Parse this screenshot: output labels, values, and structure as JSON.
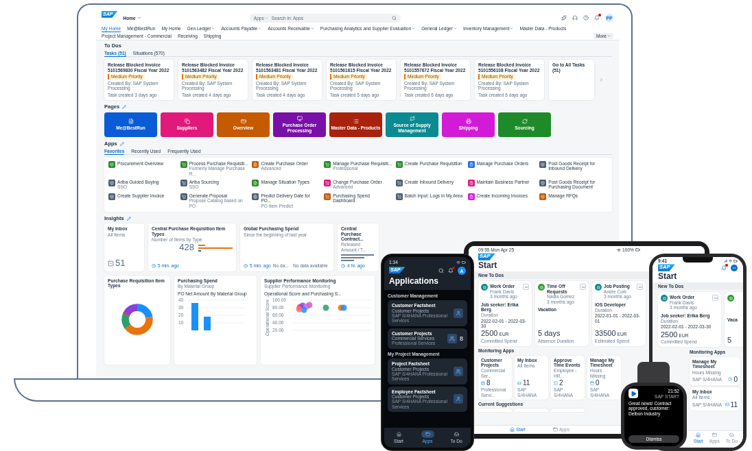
{
  "laptop": {
    "shell": {
      "logo": "SAP",
      "home_menu": "Home",
      "search": {
        "scope": "Apps",
        "placeholder": "Search in: Apps"
      },
      "unread": true,
      "avatar": "PP"
    },
    "nav": [
      {
        "label": "My Home",
        "selected": true,
        "dropdown": false
      },
      {
        "label": "Me@BestRun",
        "selected": false,
        "dropdown": false
      },
      {
        "label": "My Home",
        "selected": false,
        "dropdown": false
      },
      {
        "label": "Gen.Ledger",
        "selected": false,
        "dropdown": true
      },
      {
        "label": "Accounts Payable",
        "selected": false,
        "dropdown": true
      },
      {
        "label": "Accounts Receivable",
        "selected": false,
        "dropdown": true
      },
      {
        "label": "Purchasing Analytics and Supplier Evaluation",
        "selected": false,
        "dropdown": true
      },
      {
        "label": "General Ledger",
        "selected": false,
        "dropdown": true
      },
      {
        "label": "Inventory Management",
        "selected": false,
        "dropdown": true
      },
      {
        "label": "Master Data - Products",
        "selected": false,
        "dropdown": false
      },
      {
        "label": "Project Management - Commercial",
        "selected": false,
        "dropdown": false
      },
      {
        "label": "Receiving",
        "selected": false,
        "dropdown": false
      },
      {
        "label": "Shipping",
        "selected": false,
        "dropdown": false
      }
    ],
    "more": "More",
    "todos": {
      "title": "To Dos",
      "tabs": [
        {
          "label": "Tasks (51)",
          "selected": true
        },
        {
          "label": "Situations (570)",
          "selected": false
        }
      ],
      "tasks": [
        {
          "title": "Release Blocked Invoice 5101569830 Fiscal Year 2022",
          "priority": "Medium Priority",
          "created_by": "Created By: SAP System Processing",
          "age": "Task created 3 days ago"
        },
        {
          "title": "Release Blocked Invoice 5101563482 Fiscal Year 2022",
          "priority": "Medium Priority",
          "created_by": "Created By: SAP System Processing",
          "age": "Task created 4 days ago"
        },
        {
          "title": "Release Blocked Invoice 5101563481 Fiscal Year 2022",
          "priority": "Medium Priority",
          "created_by": "Created By: SAP System Processing",
          "age": "Task created 4 days ago"
        },
        {
          "title": "Release Blocked Invoice 5101561615 Fiscal Year 2022",
          "priority": "Medium Priority",
          "created_by": "Created By: SAP System Processing",
          "age": "Task created 5 days ago"
        },
        {
          "title": "Release Blocked Invoice 5101557672 Fiscal Year 2022",
          "priority": "Medium Priority",
          "created_by": "Created By: SAP System Processing",
          "age": "Task created 6 days ago"
        },
        {
          "title": "Release Blocked Invoice 5101556108 Fiscal Year 2022",
          "priority": "Medium Priority",
          "created_by": "Created By: SAP System Processing",
          "age": "Task created 6 days ago"
        }
      ],
      "all_tasks": "Go to All Tasks (51)"
    },
    "pages": {
      "title": "Pages",
      "tiles": [
        {
          "label": "Me@BestRun",
          "color": "#0a5bd6"
        },
        {
          "label": "Suppliers",
          "color": "#e0197a"
        },
        {
          "label": "Overview",
          "color": "#c55a00"
        },
        {
          "label": "Purchase Order Processing",
          "color": "#7a10a8"
        },
        {
          "label": "Master Data - Products",
          "color": "#a8220d"
        },
        {
          "label": "Source of Supply Management",
          "color": "#0b8a93"
        },
        {
          "label": "Shipping",
          "color": "#d21bd6"
        },
        {
          "label": "Sourcing",
          "color": "#1f8a2a"
        }
      ]
    },
    "apps": {
      "title": "Apps",
      "tabs": [
        {
          "label": "Favorites",
          "selected": true
        },
        {
          "label": "Recently Used",
          "selected": false
        },
        {
          "label": "Frequently Used",
          "selected": false
        }
      ],
      "items": [
        {
          "title": "Procurement Overview",
          "color": "#2b8a2b"
        },
        {
          "title": "Process Purchase Requisiti...",
          "subtitle": "Formerly Manage Purchase R...",
          "color": "#2b8a2b"
        },
        {
          "title": "Create Purchase Order",
          "subtitle": "Advanced",
          "color": "#c55a00"
        },
        {
          "title": "Manage Purchase Requisiti...",
          "subtitle": "Professional",
          "color": "#2b8a2b"
        },
        {
          "title": "Create Purchase Requisition",
          "color": "#2b8a2b"
        },
        {
          "title": "Manage Purchase Orders",
          "color": "#1a6ee6"
        },
        {
          "title": "Post Goods Receipt for Inbound Delivery",
          "color": "#4c5e73"
        },
        {
          "title": "Ariba Guided Buying",
          "subtitle": "SSO",
          "color": "#4c5e73"
        },
        {
          "title": "Ariba Sourcing",
          "subtitle": "SSO",
          "color": "#4c5e73"
        },
        {
          "title": "Manage Situation Types",
          "color": "#2b8a2b"
        },
        {
          "title": "Change Purchase Order",
          "subtitle": "Advanced",
          "color": "#e0197a"
        },
        {
          "title": "Create Inbound Delivery",
          "color": "#4c5e73"
        },
        {
          "title": "Maintain Business Partner",
          "color": "#e0197a"
        },
        {
          "title": "Post Goods Receipt for Purchasing Document",
          "color": "#4c5e73"
        },
        {
          "title": "Create Supplier Invoice",
          "color": "#4c5e73"
        },
        {
          "title": "Generate Proposal",
          "subtitle": "Propose Catalog based on PO",
          "color": "#4c5e73"
        },
        {
          "title": "Predict Delivery Date for PO...",
          "subtitle": "PO Item Predict",
          "color": "#4c5e73"
        },
        {
          "title": "Purchasing Spend Dashboard",
          "color": "#c55a00"
        },
        {
          "title": "Batch Input: Logs in My Area",
          "color": "#4c5e73"
        },
        {
          "title": "Create Incoming Invoices",
          "color": "#d21bd6"
        },
        {
          "title": "Manage RFQs",
          "color": "#c55a00"
        }
      ]
    },
    "insights": {
      "title": "Insights",
      "cards": [
        {
          "kind": "count",
          "title": "My Inbox",
          "subtitle": "All Items",
          "value": "51"
        },
        {
          "kind": "numbers",
          "title": "Central Purchase Requisition Item Types",
          "subtitle": "Number of Items by Type",
          "value": "428",
          "footer": "5 min. ago"
        },
        {
          "kind": "empty",
          "title": "Global Purchasing Spend",
          "subtitle": "Since the beginning of last year",
          "footer": "5 min. ago",
          "note": "No da...",
          "message": "No data available"
        },
        {
          "kind": "list",
          "title": "Central Purchase Contract...",
          "subtitle": "Released Amount / T...",
          "footer": "4 hr. ago"
        }
      ],
      "charts": [
        {
          "kind": "donut",
          "title": "Purchase Requisition Item Types"
        },
        {
          "kind": "bar",
          "title": "Purchasing Spend",
          "subtitle": "By Material Group",
          "chart_title": "PO Net Amount By Material Group",
          "ticks": [
            "40",
            "30",
            "20",
            "10"
          ]
        },
        {
          "kind": "scatter",
          "title": "Supplier Performance Monitoring",
          "subtitle": "Supplier Performance Monitoring",
          "chart_title": "Operational Score and Purchasing S...",
          "axis_label": "Operational Score",
          "ticks": [
            "100.00",
            "80.00",
            "60.00",
            "40.00",
            "20.00"
          ]
        }
      ]
    }
  },
  "android_phone": {
    "time": "1:34",
    "logo": "SAP",
    "unread": true,
    "avatar": "A",
    "title": "Applications",
    "sections": [
      {
        "title": "Customer Management",
        "apps": [
          {
            "title": "Customer Factsheet",
            "subtitle": "Customer Projects",
            "detail": "SAP S/4HANA Professional Services"
          },
          {
            "title": "Customer Projects",
            "subtitle": "Commercial Services",
            "detail": "Professional Services",
            "count": "8"
          }
        ]
      },
      {
        "title": "My Project Management",
        "apps": [
          {
            "title": "Project Factsheet",
            "subtitle": "Customer Projects",
            "detail": "SAP S/4HANA Professional Services"
          },
          {
            "title": "Employee Factsheet",
            "subtitle": "Customer Projects",
            "detail": "SAP S/4HANA Professional Services"
          }
        ]
      }
    ],
    "tabs": [
      {
        "label": "Start",
        "selected": false
      },
      {
        "label": "Apps",
        "selected": true
      },
      {
        "label": "To Do",
        "selected": false
      }
    ]
  },
  "tablet": {
    "status_time": "09:55 Mon Apr 25",
    "battery": "100%",
    "logo": "SAP",
    "title": "Start",
    "todos_title": "New To Dos",
    "todos": [
      {
        "title": "Work Order",
        "person": "Frank Davis",
        "age": "3 months ago",
        "headline": "Job seeker: Erika Berg",
        "detail_label": "Duration",
        "detail": "2022-02-01 - 2022-03-30",
        "amount": "2500",
        "unit": "EUR",
        "amount_label": "Committed Spend",
        "color": "#0f8a8a"
      },
      {
        "title": "Time Off Requests",
        "person": "Nadia Gomez",
        "age": "3 months ago",
        "headline": "Vacation",
        "amount": "5 days",
        "amount_label": "Absence Duration",
        "color": "#2e9e2e"
      },
      {
        "title": "Job Posting",
        "person": "Andre Cork",
        "age": "3 months ago",
        "headline": "iOS Developer",
        "detail_label": "Duration",
        "detail": "2022-01-01 - 2022-03-01",
        "amount": "33500",
        "unit": "EUR",
        "amount_label": "Estimated Spend",
        "color": "#0f8a8a"
      }
    ],
    "monitoring_title": "Monitoring Apps",
    "monitoring": [
      {
        "title": "Customer Projects",
        "subtitle": "Commercial Ser...",
        "value": "8",
        "footer": "Professional Servi..."
      },
      {
        "title": "My Inbox",
        "subtitle": "All Items",
        "value": "11",
        "footer": "SAP S/4HANA"
      },
      {
        "title": "Approve Time Events",
        "subtitle": "Employee - HR...",
        "value": "2",
        "footer": "SAP S/4HANA"
      },
      {
        "title": "Manage My Timesheet",
        "subtitle": "Hours Missing",
        "value": "0",
        "footer": "SAP S/4HANA"
      }
    ],
    "suggestions_title": "Current Suggestions",
    "tabs": [
      {
        "label": "Start",
        "selected": true
      },
      {
        "label": "Apps",
        "selected": false
      }
    ]
  },
  "iphone": {
    "time": "9:41",
    "logo": "SAP",
    "unread": true,
    "title": "Start",
    "todos_title": "New To Dos",
    "todo": {
      "title": "Work Order",
      "person": "Frank Davis",
      "age": "3 months ago",
      "headline": "Job seeker: Erika Berg",
      "detail_label": "Duration",
      "detail": "2022-02-01 - 2022-03-30",
      "amount": "2500",
      "unit": "EUR",
      "amount_label": "Committed Spend",
      "color": "#0f8a8a"
    },
    "peek": {
      "title": "Vaca",
      "amount": "5",
      "color": "#2e9e2e"
    },
    "monitoring_title": "Monitoring Apps",
    "monitoring": [
      {
        "title": "Manage My Timesheet",
        "subtitle": "Hours Missing",
        "footer": "SAP S/4HANA",
        "value": "0"
      },
      {
        "title": "My Inbox",
        "subtitle": "All Items",
        "footer": "SAP S/4HANA",
        "value": "11"
      }
    ],
    "tabs": [
      {
        "label": "Start",
        "selected": true
      },
      {
        "label": "Apps",
        "selected": false
      },
      {
        "label": "To Do",
        "selected": false
      }
    ]
  },
  "watch": {
    "time": "21:52",
    "app": "SAP START",
    "message": "Great news! Contract approved, customer: Delbon Industry",
    "button": "Dismiss"
  }
}
